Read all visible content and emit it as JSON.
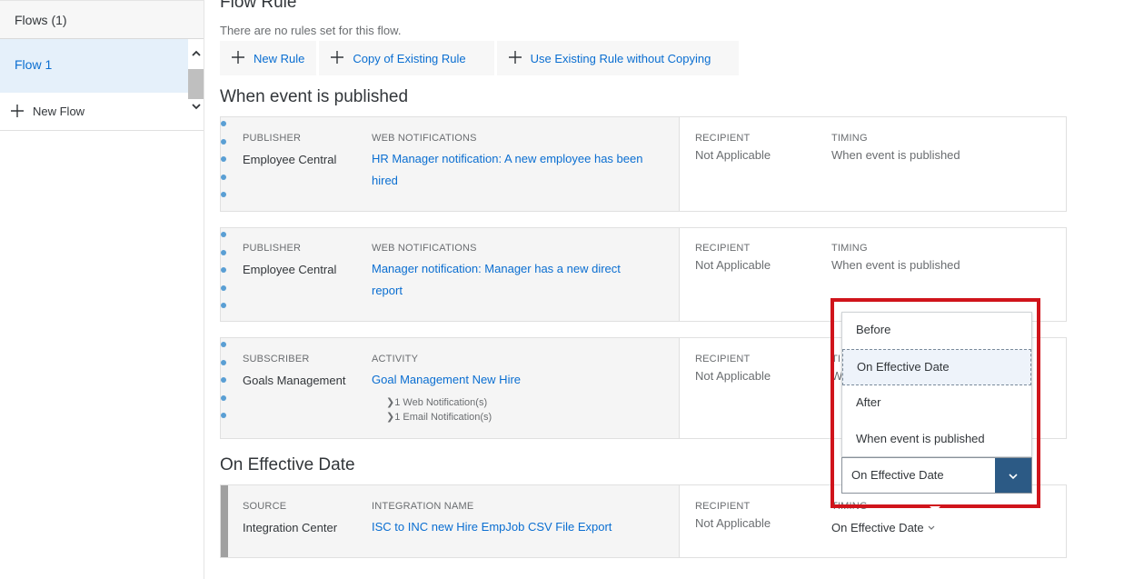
{
  "sidebar": {
    "header": "Flows (1)",
    "selected_flow": "Flow 1",
    "new_flow": "New Flow",
    "scroll_up": "⌃",
    "scroll_down": "⌄"
  },
  "main": {
    "title": "Flow Rule",
    "no_rules_text": "There are no rules set for this flow.",
    "buttons": {
      "new_rule": "New Rule",
      "copy_rule": "Copy of Existing Rule",
      "use_existing": "Use Existing Rule without Copying"
    },
    "sections": {
      "published": "When event is published",
      "effective": "On Effective Date"
    }
  },
  "cards": [
    {
      "col1_label": "PUBLISHER",
      "col1_value": "Employee Central",
      "col2_label": "WEB NOTIFICATIONS",
      "col2_line1": "HR Manager notification: A new employee has been",
      "col2_line2": "hired",
      "recipient_label": "RECIPIENT",
      "recipient_value": "Not Applicable",
      "timing_label": "TIMING",
      "timing_value": "When event is published"
    },
    {
      "col1_label": "PUBLISHER",
      "col1_value": "Employee Central",
      "col2_label": "WEB NOTIFICATIONS",
      "col2_line1": "Manager notification: Manager has a new direct",
      "col2_line2": "report",
      "recipient_label": "RECIPIENT",
      "recipient_value": "Not Applicable",
      "timing_label": "TIMING",
      "timing_value": "When event is published"
    },
    {
      "col1_label": "SUBSCRIBER",
      "col1_value": "Goals Management",
      "col2_label": "ACTIVITY",
      "col2_line1": "Goal Management New Hire",
      "sub1": "1 Web Notification(s)",
      "sub2": "1 Email Notification(s)",
      "recipient_label": "RECIPIENT",
      "recipient_value": "Not Applicable",
      "timing_label": "TI",
      "timing_value": "W"
    },
    {
      "col1_label": "SOURCE",
      "col1_value": "Integration Center",
      "col2_label": "INTEGRATION NAME",
      "col2_line1": "ISC to INC new Hire EmpJob CSV File Export",
      "recipient_label": "RECIPIENT",
      "recipient_value": "Not Applicable",
      "timing_label": "TIMING",
      "timing_value": "On Effective Date"
    }
  ],
  "dropdown": {
    "options": [
      "Before",
      "On Effective Date",
      "After",
      "When event is published"
    ],
    "selected": "On Effective Date",
    "current_value": "On Effective Date"
  },
  "colors": {
    "link": "#0a6ed1",
    "highlight_frame": "#d0141b",
    "select_button": "#2c5a85",
    "dot": "#5a9fd4"
  }
}
